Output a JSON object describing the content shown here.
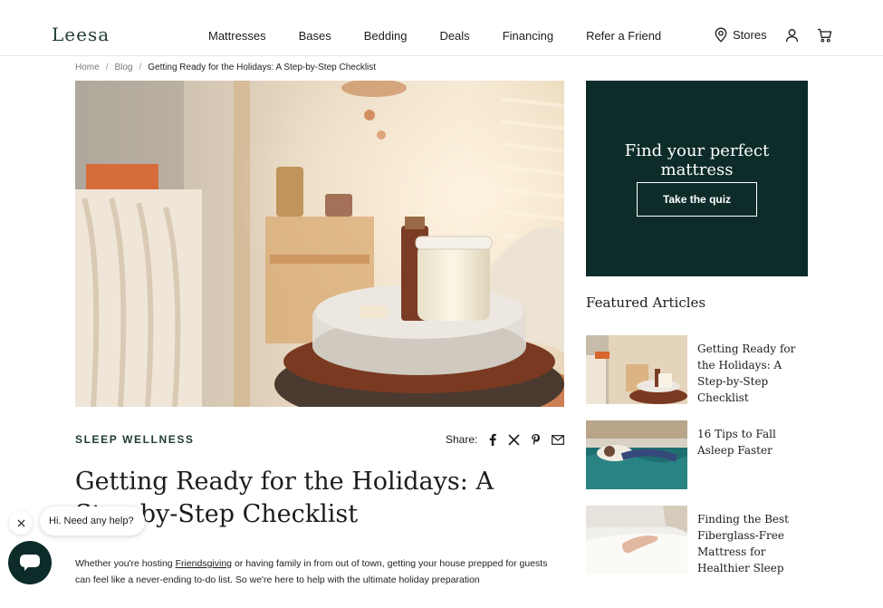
{
  "header": {
    "logo": "Leesa",
    "nav": [
      "Mattresses",
      "Bases",
      "Bedding",
      "Deals",
      "Financing",
      "Refer a Friend"
    ],
    "stores_label": "Stores"
  },
  "breadcrumb": {
    "home": "Home",
    "blog": "Blog",
    "current": "Getting Ready for the Holidays: A Step-by-Step Checklist"
  },
  "article": {
    "category": "SLEEP WELLNESS",
    "share_label": "Share:",
    "title": "Getting Ready for the Holidays: A Step-by-Step Checklist",
    "intro_before_link": "Whether you're hosting ",
    "intro_link": "Friendsgiving",
    "intro_after_link": " or having family in from out of town, getting your house prepped for guests can feel like a never-ending to-do list. So we're here to help with the ultimate holiday preparation"
  },
  "quiz": {
    "title": "Find your perfect mattress",
    "button": "Take the quiz"
  },
  "featured": {
    "heading": "Featured Articles",
    "items": [
      {
        "title": "Getting Ready for the Holidays: A Step-by-Step Checklist"
      },
      {
        "title": "16 Tips to Fall Asleep Faster"
      },
      {
        "title": "Finding the Best Fiberglass-Free Mattress for Healthier Sleep"
      }
    ]
  },
  "chat": {
    "message": "Hi. Need any help?"
  },
  "colors": {
    "brand_dark": "#0d2c29",
    "logo": "#1f3b37"
  },
  "icons": [
    "location-pin-icon",
    "user-icon",
    "cart-icon",
    "facebook-icon",
    "x-icon",
    "pinterest-icon",
    "email-icon",
    "close-icon",
    "chat-icon"
  ]
}
